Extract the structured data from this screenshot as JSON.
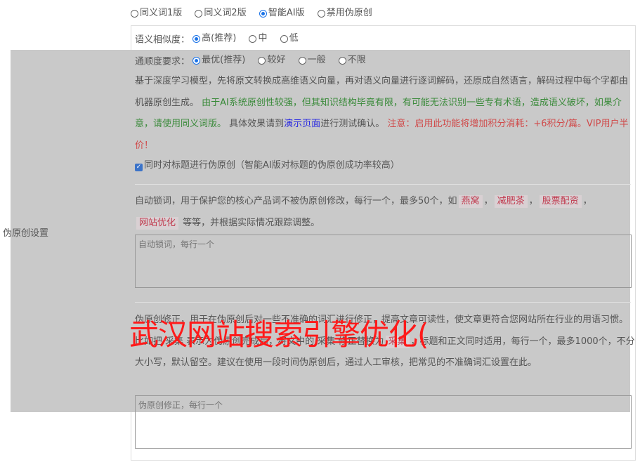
{
  "top_radios": [
    {
      "label": "同义词1版",
      "checked": false
    },
    {
      "label": "同义词2版",
      "checked": false
    },
    {
      "label": "智能AI版",
      "checked": true
    },
    {
      "label": "禁用伪原创",
      "checked": false
    }
  ],
  "similarity": {
    "label": "语义相似度：",
    "options": [
      {
        "label": "高(推荐)",
        "checked": true
      },
      {
        "label": "中",
        "checked": false
      },
      {
        "label": "低",
        "checked": false
      }
    ]
  },
  "fluency": {
    "label": "通顺度要求：",
    "options": [
      {
        "label": "最优(推荐)",
        "checked": true
      },
      {
        "label": "较好",
        "checked": false
      },
      {
        "label": "一般",
        "checked": false
      },
      {
        "label": "不限",
        "checked": false
      }
    ]
  },
  "side_label": "伪原创设置",
  "desc": {
    "part1": "基于深度学习模型，先将原文转换成高维语义向量，再对语义向量进行逐词解码，还原成自然语言，解码过程中每个字都由机器原创生成。",
    "part2": "由于AI系统原创性较强，但其知识结构毕竟有限，有可能无法识别一些专有术语，造成语义破坏，如果介意，请使用同义词版。",
    "part3": "具体效果请到",
    "link": "演示页面",
    "part4": "进行测试确认。",
    "part5": "注意：启用此功能将增加积分消耗：+6积分/篇。VIP用户半价！"
  },
  "title_checkbox": "同时对标题进行伪原创（智能AI版对标题的伪原创成功率较高）",
  "lock": {
    "text1": "自动锁词，用于保护您的核心产品词不被伪原创修改，每行一个，最多50个，如",
    "tags": [
      "燕窝",
      "减肥茶",
      "股票配资",
      "网站优化"
    ],
    "text2": "等等，并根据实际情况跟踪调整。",
    "placeholder": "自动锁词，每行一个"
  },
  "correct": {
    "text": "伪原创修正，用于在伪原创后对一些不准确的词汇进行修正，提高文章可读性，使文章更符合您网站所在行业的用语习惯。比如把 采集 表示为伪原创完成后，将文中的 采集 修正替换为",
    "tag": "采集",
    "text2": "，标题和正文同时适用，每行一个，最多1000个，不分大小写，默认留空。建议在使用一段时间伪原创后，通过人工审核，把常见的不准确词汇设置在此。",
    "placeholder": "伪原创修正，每行一个"
  },
  "watermark": "武汉网站搜索引擎优化(",
  "colors": {
    "overlay": "#c9c9c9",
    "watermark": "#ff1a1a",
    "accent": "#1a73e8"
  }
}
